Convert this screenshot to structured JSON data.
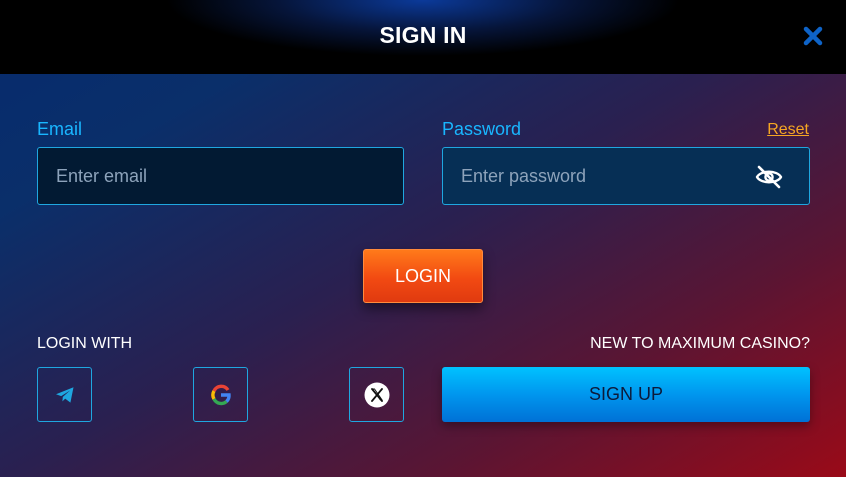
{
  "modal": {
    "title": "SIGN IN",
    "close_icon": "close-x-icon"
  },
  "email": {
    "label": "Email",
    "placeholder": "Enter email",
    "value": ""
  },
  "password": {
    "label": "Password",
    "placeholder": "Enter password",
    "value": "",
    "reset_label": "Reset",
    "toggle_icon": "eye-slash-icon"
  },
  "login_button": {
    "label": "LOGIN"
  },
  "social": {
    "label": "LOGIN WITH",
    "providers": [
      {
        "name": "Telegram",
        "icon": "telegram-icon"
      },
      {
        "name": "Google",
        "icon": "google-icon"
      },
      {
        "name": "X",
        "icon": "x-icon"
      }
    ]
  },
  "signup": {
    "prompt": "NEW TO MAXIMUM CASINO?",
    "button_label": "SIGN UP"
  },
  "colors": {
    "accent_blue": "#19b6ff",
    "reset_orange": "#f5a623",
    "login_orange": "#f24a12",
    "signup_blue": "#0096ee"
  }
}
